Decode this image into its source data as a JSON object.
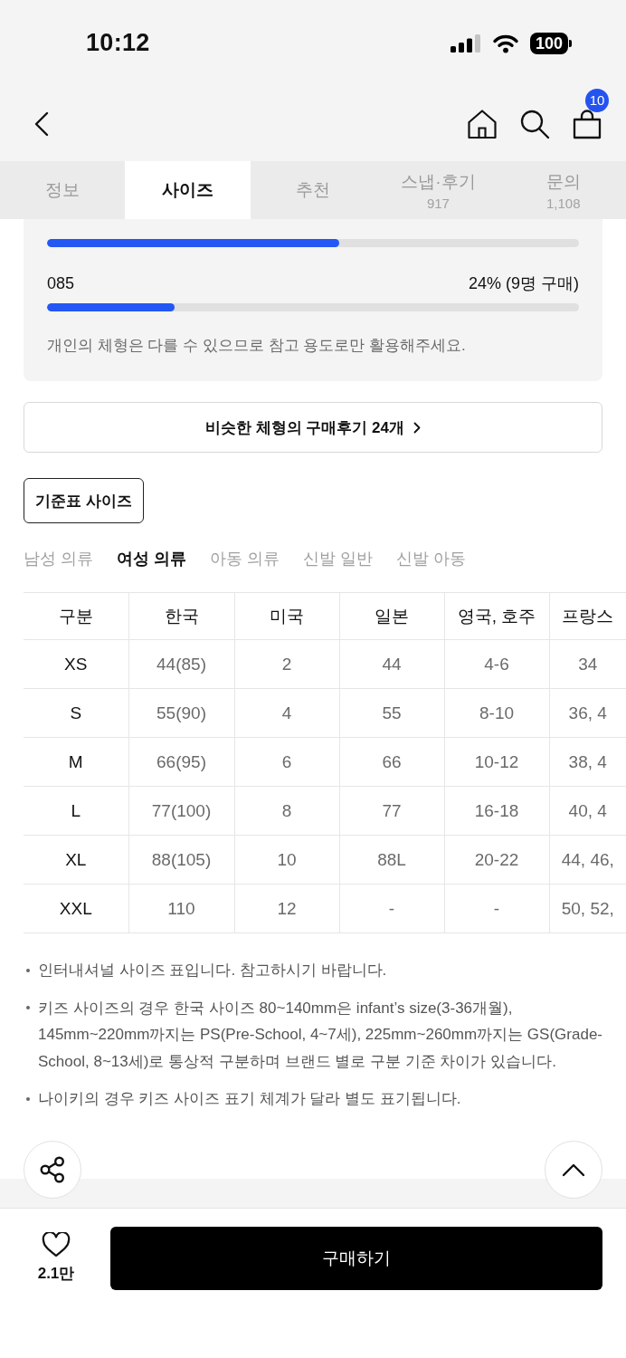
{
  "status_bar": {
    "time": "10:12",
    "battery": "100"
  },
  "nav": {
    "cart_count": "10"
  },
  "tabs": [
    {
      "label": "정보",
      "selected": false
    },
    {
      "label": "사이즈",
      "selected": true
    },
    {
      "label": "추천",
      "selected": false
    },
    {
      "label": "스냅·후기",
      "count": "917",
      "selected": false
    },
    {
      "label": "문의",
      "count": "1,108",
      "selected": false
    }
  ],
  "size_distribution": {
    "bars": [
      {
        "level": 0.55
      },
      {
        "label": "085",
        "reading": "24% (9명 구매)",
        "level": 0.24
      }
    ],
    "note": "개인의 체형은 다를 수 있으므로 참고 용도로만 활용해주세요."
  },
  "similar_reviews_button": "비슷한 체형의 구매후기 24개",
  "size_chart_button": "기준표 사이즈",
  "categories": [
    {
      "label": "남성 의류",
      "selected": false
    },
    {
      "label": "여성 의류",
      "selected": true
    },
    {
      "label": "아동 의류",
      "selected": false
    },
    {
      "label": "신발 일반",
      "selected": false
    },
    {
      "label": "신발 아동",
      "selected": false
    }
  ],
  "size_table": {
    "columns": [
      "구분",
      "한국",
      "미국",
      "일본",
      "영국, 호주",
      "프랑스"
    ],
    "rows": [
      [
        "XS",
        "44(85)",
        "2",
        "44",
        "4-6",
        "34"
      ],
      [
        "S",
        "55(90)",
        "4",
        "55",
        "8-10",
        "36, 4"
      ],
      [
        "M",
        "66(95)",
        "6",
        "66",
        "10-12",
        "38, 4"
      ],
      [
        "L",
        "77(100)",
        "8",
        "77",
        "16-18",
        "40, 4"
      ],
      [
        "XL",
        "88(105)",
        "10",
        "88L",
        "20-22",
        "44, 46,"
      ],
      [
        "XXL",
        "110",
        "12",
        "-",
        "-",
        "50, 52,"
      ]
    ]
  },
  "notes": [
    "인터내셔널 사이즈 표입니다. 참고하시기 바랍니다.",
    "키즈 사이즈의 경우 한국 사이즈 80~140mm은 infant’s size(3-36개월), 145mm~220mm까지는 PS(Pre-School, 4~7세), 225mm~260mm까지는 GS(Grade-School, 8~13세)로 통상적 구분하며 브랜드 별로 구분 기준 차이가 있습니다.",
    "나이키의 경우 키즈 사이즈 표기 체계가 달라 별도 표기됩니다."
  ],
  "like_count": "2.1만",
  "buy_button": "구매하기"
}
